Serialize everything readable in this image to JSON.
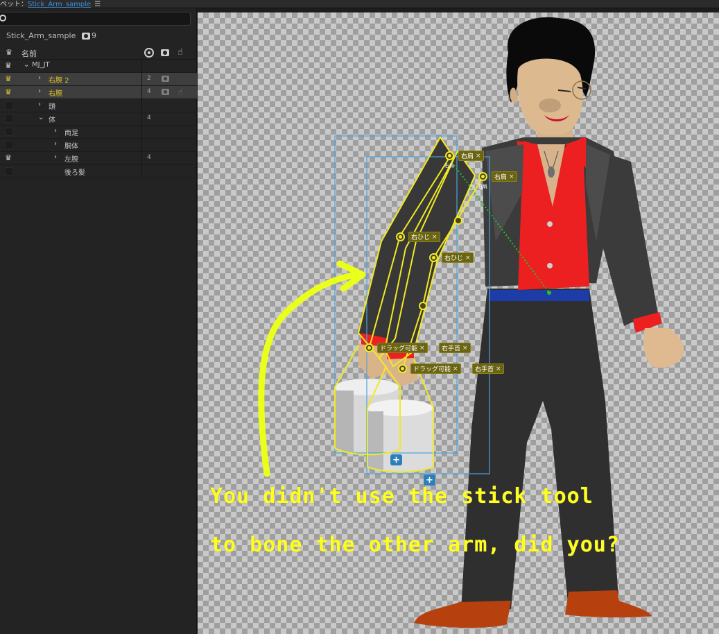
{
  "topbar": {
    "prefix": "ペット：",
    "document": "Stick_Arm_sample",
    "menu_glyph": "☰"
  },
  "search": {
    "value": ""
  },
  "project": {
    "name": "Stick_Arm_sample",
    "count": "9"
  },
  "layers_header": {
    "name_label": "名前"
  },
  "layers": [
    {
      "label": "MJ_JT",
      "count": ""
    },
    {
      "label": "右腕 2",
      "count": "2"
    },
    {
      "label": "右腕",
      "count": "4"
    },
    {
      "label": "頭",
      "count": ""
    },
    {
      "label": "体",
      "count": "4"
    },
    {
      "label": "両足",
      "count": ""
    },
    {
      "label": "胴体",
      "count": ""
    },
    {
      "label": "左腕",
      "count": "4"
    },
    {
      "label": "後ろ髪",
      "count": ""
    }
  ],
  "handles": {
    "shoulder_a": "右肩",
    "shoulder_b": "右肩",
    "shoulder_a_small": "右肩",
    "shoulder_b_small": "右肩",
    "elbow_a": "右ひじ",
    "elbow_b": "右ひじ",
    "drag_a": "ドラッグ可能",
    "drag_b": "ドラッグ可能",
    "wrist_a": "右手首",
    "wrist_b": "右手首",
    "close": "×"
  },
  "plus_label": "+",
  "caption": {
    "line1": "You didn't use the stick tool",
    "line2": "to bone the other arm, did you?"
  },
  "colors": {
    "accent_yellow": "#f2ea21",
    "caption_yellow": "#ffff1e",
    "selection_blue": "#4ea3e0",
    "shirt_red": "#ec2020",
    "shoe_orange": "#c0410c"
  }
}
